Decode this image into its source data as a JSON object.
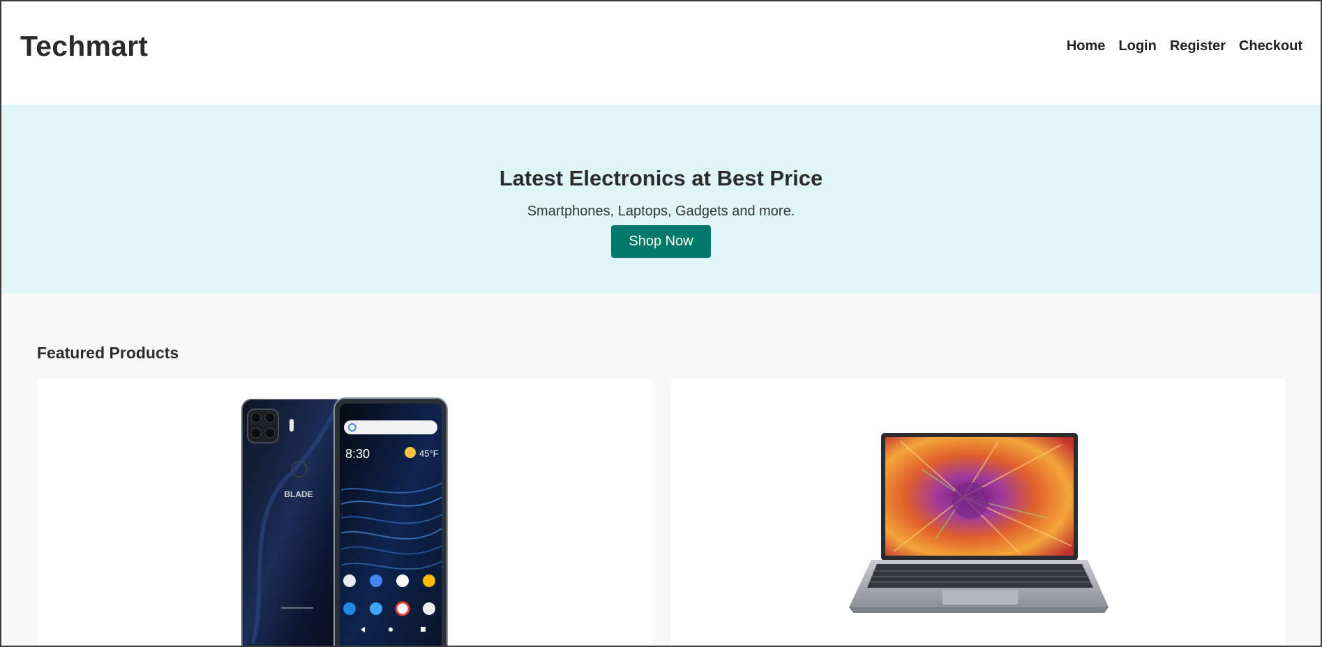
{
  "brand": {
    "name": "Techmart"
  },
  "nav": {
    "home": "Home",
    "login": "Login",
    "register": "Register",
    "checkout": "Checkout"
  },
  "hero": {
    "title": "Latest Electronics at Best Price",
    "subtitle": "Smartphones, Laptops, Gadgets and more.",
    "cta_label": "Shop Now"
  },
  "featured": {
    "title": "Featured Products",
    "products": [
      {
        "image": "smartphone-image",
        "phone": {
          "brand_text": "BLADE",
          "time": "8:30",
          "temperature": "45°F"
        }
      },
      {
        "image": "laptop-image"
      }
    ]
  },
  "colors": {
    "accent": "#00796b",
    "hero_bg": "#dff5f8",
    "page_bg": "#f8f8f8"
  }
}
